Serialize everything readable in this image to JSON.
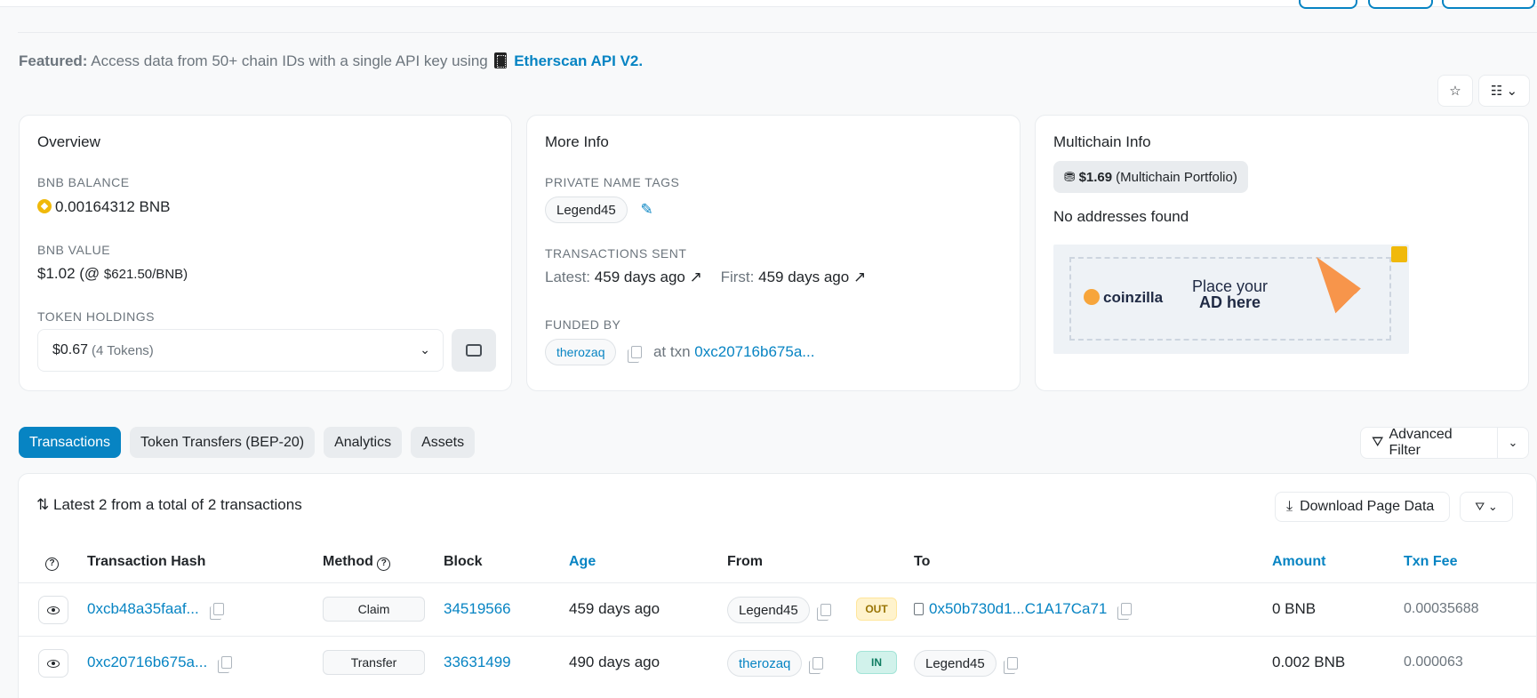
{
  "featured": {
    "label": "Featured:",
    "text": "Access data from 50+ chain IDs with a single API key using",
    "link": "Etherscan API V2."
  },
  "overview": {
    "title": "Overview",
    "balance_label": "BNB BALANCE",
    "balance_value": "0.00164312 BNB",
    "value_label": "BNB VALUE",
    "value_main": "$1.02 (@",
    "value_price": "$621.50/BNB)",
    "holdings_label": "TOKEN HOLDINGS",
    "holdings_value": "$0.67",
    "holdings_count": "(4 Tokens)"
  },
  "more_info": {
    "title": "More Info",
    "tags_label": "PRIVATE NAME TAGS",
    "tag": "Legend45",
    "sent_label": "TRANSACTIONS SENT",
    "latest_label": "Latest:",
    "latest_value": "459 days ago",
    "first_label": "First:",
    "first_value": "459 days ago",
    "funded_label": "FUNDED BY",
    "funded_by": "therozaq",
    "at_txn": "at txn",
    "funded_txn": "0xc20716b675a..."
  },
  "multichain": {
    "title": "Multichain Info",
    "portfolio_value": "$1.69",
    "portfolio_label": "(Multichain Portfolio)",
    "no_addresses": "No addresses found",
    "ad_brand": "coinzilla",
    "ad_line1": "Place your",
    "ad_line2": "AD here"
  },
  "tabs": [
    {
      "label": "Transactions",
      "active": true
    },
    {
      "label": "Token Transfers (BEP-20)",
      "active": false
    },
    {
      "label": "Analytics",
      "active": false
    },
    {
      "label": "Assets",
      "active": false
    }
  ],
  "advanced_filter": "Advanced Filter",
  "table": {
    "summary": "Latest 2 from a total of 2 transactions",
    "download": "Download Page Data",
    "headers": {
      "hash": "Transaction Hash",
      "method": "Method",
      "block": "Block",
      "age": "Age",
      "from": "From",
      "to": "To",
      "amount": "Amount",
      "fee": "Txn Fee"
    },
    "rows": [
      {
        "hash": "0xcb48a35faaf...",
        "method": "Claim",
        "block": "34519566",
        "age": "459 days ago",
        "from": "Legend45",
        "direction": "OUT",
        "to": "0x50b730d1...C1A17Ca71",
        "amount": "0 BNB",
        "fee": "0.00035688"
      },
      {
        "hash": "0xc20716b675a...",
        "method": "Transfer",
        "block": "33631499",
        "age": "490 days ago",
        "from": "therozaq",
        "direction": "IN",
        "to": "Legend45",
        "amount": "0.002 BNB",
        "fee": "0.000063"
      }
    ]
  },
  "colors": {
    "accent": "#0784c3",
    "out_badge": "#fff3cd",
    "in_badge": "#d1f2eb"
  }
}
